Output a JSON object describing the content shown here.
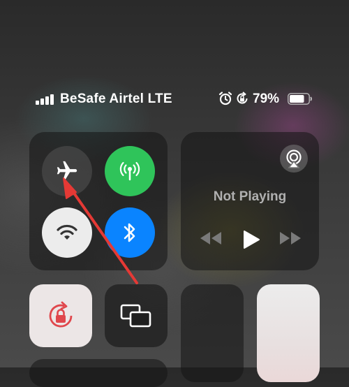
{
  "status_bar": {
    "carrier": "BeSafe Airtel LTE",
    "battery_percent": "79%",
    "signal_bars": 4,
    "battery_level": 0.79,
    "icons": [
      "signal-icon",
      "alarm-icon",
      "orientation-lock-icon",
      "battery-icon"
    ]
  },
  "connectivity": {
    "airplane_mode": {
      "icon": "airplane-icon",
      "active": false
    },
    "cellular_data": {
      "icon": "antenna-icon",
      "active": true,
      "color": "#2fc45a"
    },
    "wifi": {
      "icon": "wifi-icon",
      "active": true,
      "color": "#ececec"
    },
    "bluetooth": {
      "icon": "bluetooth-icon",
      "active": true,
      "color": "#0a84ff"
    }
  },
  "media": {
    "status": "Not Playing",
    "controls": [
      "rewind-icon",
      "play-icon",
      "fast-forward-icon"
    ],
    "airplay_icon": "airplay-audio-icon"
  },
  "tiles": {
    "rotation_lock": {
      "icon": "rotation-lock-icon",
      "active": true,
      "color": "#e0474c"
    },
    "screen_mirroring": {
      "icon": "screen-mirroring-icon"
    }
  },
  "annotation": {
    "arrow_color": "#e53935",
    "target": "airplane-mode-button"
  }
}
